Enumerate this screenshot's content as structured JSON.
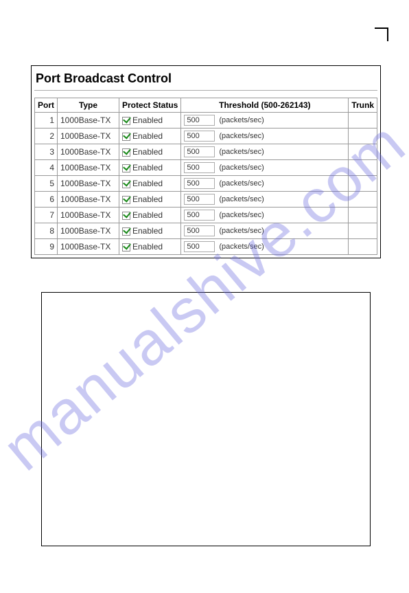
{
  "watermark": "manualshive.com",
  "title": "Port Broadcast Control",
  "headers": {
    "port": "Port",
    "type": "Type",
    "protect": "Protect Status",
    "threshold": "Threshold (500-262143)",
    "trunk": "Trunk"
  },
  "protect_label": "Enabled",
  "unit": "(packets/sec)",
  "rows": [
    {
      "port": "1",
      "type": "1000Base-TX",
      "checked": true,
      "threshold": "500",
      "trunk": ""
    },
    {
      "port": "2",
      "type": "1000Base-TX",
      "checked": true,
      "threshold": "500",
      "trunk": ""
    },
    {
      "port": "3",
      "type": "1000Base-TX",
      "checked": true,
      "threshold": "500",
      "trunk": ""
    },
    {
      "port": "4",
      "type": "1000Base-TX",
      "checked": true,
      "threshold": "500",
      "trunk": ""
    },
    {
      "port": "5",
      "type": "1000Base-TX",
      "checked": true,
      "threshold": "500",
      "trunk": ""
    },
    {
      "port": "6",
      "type": "1000Base-TX",
      "checked": true,
      "threshold": "500",
      "trunk": ""
    },
    {
      "port": "7",
      "type": "1000Base-TX",
      "checked": true,
      "threshold": "500",
      "trunk": ""
    },
    {
      "port": "8",
      "type": "1000Base-TX",
      "checked": true,
      "threshold": "500",
      "trunk": ""
    },
    {
      "port": "9",
      "type": "1000Base-TX",
      "checked": true,
      "threshold": "500",
      "trunk": ""
    }
  ]
}
